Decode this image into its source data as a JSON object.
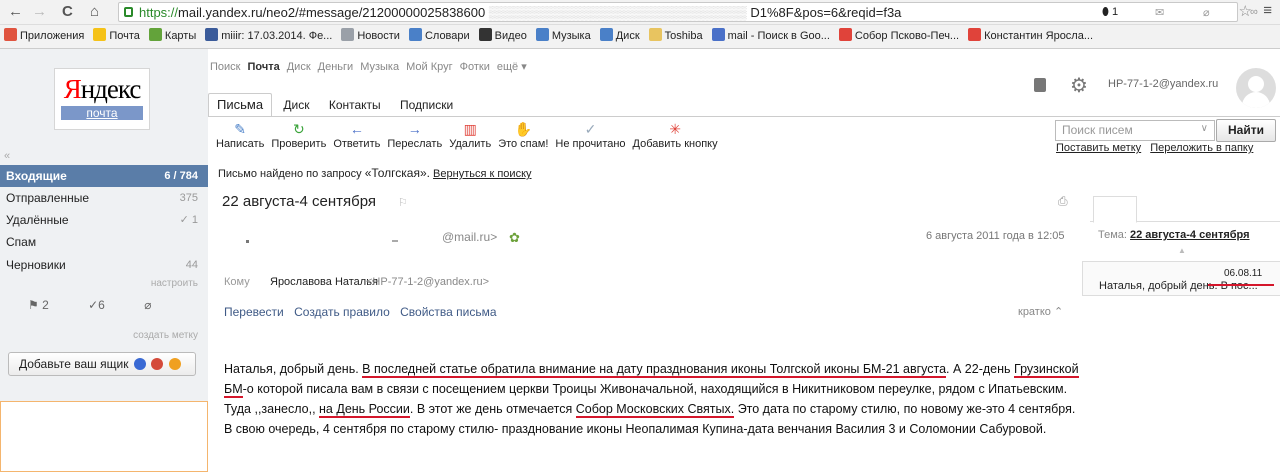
{
  "browser": {
    "back": "←",
    "forward": "→",
    "reload": "C",
    "home": "⌂",
    "url_scheme": "https://",
    "url_rest": "mail.yandex.ru/neo2/#message/21200000025838600",
    "url_tail": "D1%8F&pos=6&reqid=f3a",
    "bookmarks": [
      {
        "label": "Приложения",
        "color": "#e0543f"
      },
      {
        "label": "Почта",
        "color": "#f5c218"
      },
      {
        "label": "Карты",
        "color": "#63a33a"
      },
      {
        "label": "miiir: 17.03.2014. Фе...",
        "color": "#3b5b9a"
      },
      {
        "label": "Новости",
        "color": "#9aa0a8"
      },
      {
        "label": "Словари",
        "color": "#4a80c8"
      },
      {
        "label": "Видео",
        "color": "#333333"
      },
      {
        "label": "Музыка",
        "color": "#4a80c8"
      },
      {
        "label": "Диск",
        "color": "#4a80c8"
      },
      {
        "label": "Toshiba",
        "color": "#e8c460"
      },
      {
        "label": "mail - Поиск в Goo...",
        "color": "#4a70c8"
      },
      {
        "label": "Собор Псково-Печ...",
        "color": "#e0433a"
      },
      {
        "label": "Константин Яросла...",
        "color": "#e0433a"
      }
    ]
  },
  "logo": {
    "word_red": "Я",
    "word_black": "ндекс",
    "sub": "почта"
  },
  "collapse": "«",
  "folders": [
    {
      "label": "Входящие",
      "count": "6 / 784"
    },
    {
      "label": "Отправленные",
      "count": "375"
    },
    {
      "label": "Удалённые",
      "count": "✓ 1"
    },
    {
      "label": "Спам",
      "count": ""
    },
    {
      "label": "Черновики",
      "count": "44"
    }
  ],
  "folders_setup": "настроить",
  "marks": {
    "flag": "⚑ 2",
    "check": "✓6",
    "clip": "⌀"
  },
  "marks_create": "создать метку",
  "add_mailbox": "Добавьте ваш ящик",
  "topnav": [
    "Поиск",
    "Почта",
    "Диск",
    "Деньги",
    "Музыка",
    "Мой Круг",
    "Фотки",
    "ещё ▾"
  ],
  "tabs": [
    "Письма",
    "Диск",
    "Контакты",
    "Подписки"
  ],
  "user": {
    "email": "HP-77-1-2@yandex.ru"
  },
  "toolbar": [
    {
      "label": "Написать",
      "icon": "✎",
      "color": "#4a80c8"
    },
    {
      "label": "Проверить",
      "icon": "↻",
      "color": "#3aa33a"
    },
    {
      "label": "Ответить",
      "icon": "←",
      "color": "#4a70c8"
    },
    {
      "label": "Переслать",
      "icon": "→",
      "color": "#4a70c8"
    },
    {
      "label": "Удалить",
      "icon": "▥",
      "color": "#e0433a"
    },
    {
      "label": "Это спам!",
      "icon": "✋",
      "color": "#f0a020"
    },
    {
      "label": "Не прочитано",
      "icon": "✓",
      "color": "#9ab"
    },
    {
      "label": "Добавить кнопку",
      "icon": "✳",
      "color": "#e0433a"
    }
  ],
  "search": {
    "placeholder": "Поиск писем",
    "button": "Найти"
  },
  "tlinks": [
    "Поставить метку",
    "Переложить в папку"
  ],
  "found": {
    "prefix": "Письмо найдено по запросу ",
    "query": "«Толгская».",
    "back": "Вернуться к поиску"
  },
  "message": {
    "subject": "22 августа-4 сентября",
    "from_mail": "@mail.ru>",
    "date": "6 августа 2011 года в 12:05",
    "to_label": "Кому",
    "to_name": "Ярославова Наталья",
    "to_mail": "<HP-77-1-2@yandex.ru>",
    "actions": [
      "Перевести",
      "Создать правило",
      "Свойства письма"
    ],
    "briefly": "кратко ⌃",
    "body": {
      "p1": "Наталья, добрый день. ",
      "u1": "В последней статье обратила внимание на дату празднования иконы Толгской иконы БМ-21 августа",
      "p2": ". А 22-день ",
      "u2": "Грузинской БМ",
      "p3": "-о которой писала вам в связи с посещением церкви Троицы Живоначальной, находящийся в Никитниковом переулке, рядом с Ипатьевским. Туда ,,занесло,, ",
      "u3": "на День России",
      "p4": ". В этот же день отмечается ",
      "u4": "Собор Московских Святых.",
      "p5": " Это дата по старому стилю, по новому же-это 4 сентября. В свою очередь, 4 сентября по старому стилю- празднование иконы Неопалимая Купина-дата венчания Василия 3 и Соломонии Сабуровой."
    }
  },
  "thread": {
    "tab_count": "1",
    "topic_label": "Тема: ",
    "topic": "22 августа-4 сентября",
    "item_date": "06.08.11",
    "item_text": "Наталья, добрый день. В пос..."
  },
  "colors": {
    "accent": "#5a7da8",
    "underline": "#d4162b",
    "link": "#3f5a86"
  }
}
